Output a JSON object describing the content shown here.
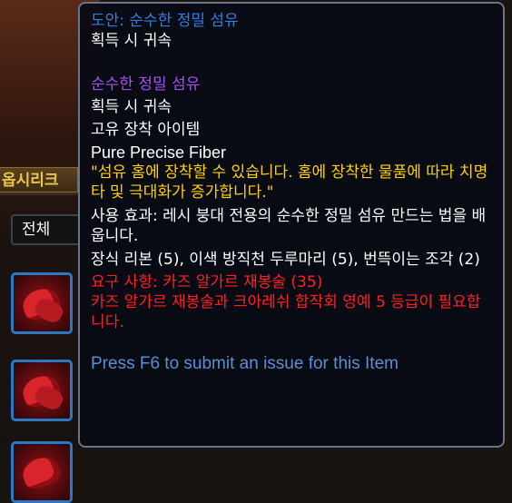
{
  "background": {
    "tab_label": "옵시리크",
    "filter_value": "전체"
  },
  "tooltip": {
    "blueprint_title": "도안: 순수한 정밀 섬유",
    "blueprint_binding": "획득 시 귀속",
    "item_name": "순수한 정밀 섬유",
    "item_binding": "획득 시 귀속",
    "item_unique": "고유 장착 아이템",
    "item_english_name": "Pure Precise Fiber",
    "flavor_text": "\"섬유 홈에 장착할 수 있습니다. 홈에 장착한 물품에 따라 치명타 및 극대화가 증가합니다.\"",
    "use_effect": "사용 효과: 레시 붕대 전용의 순수한 정밀 섬유 만드는 법을 배웁니다.",
    "reagents": "장식 리본 (5), 이색 방직천 두루마리 (5), 번뜩이는 조각 (2)",
    "requirement": "요구 사항: 카즈 알가르 재봉술 (35)",
    "reputation_requirement": "카즈 알가르 재봉술과 크아레쉬 합작회 영예 5 등급이 필요합니다.",
    "press_hint": "Press F6 to submit an issue for this Item"
  },
  "colors": {
    "blue": "#2f7fe0",
    "purple": "#a64ff2",
    "yellow": "#ffd100",
    "red": "#ff2020"
  }
}
